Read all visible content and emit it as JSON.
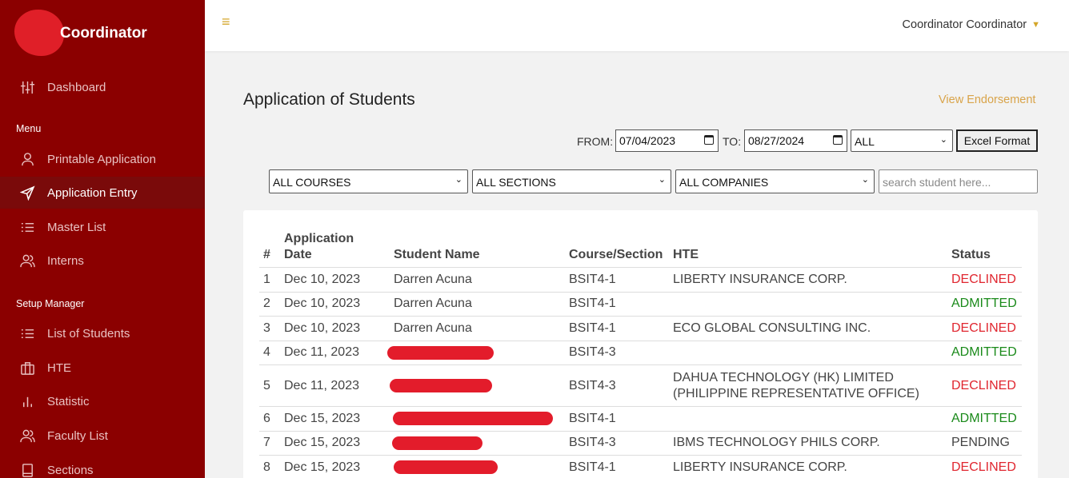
{
  "sidebar": {
    "brand": "Coordinator",
    "items": [
      {
        "label": "Dashboard",
        "icon": "sliders-icon"
      },
      {
        "label": "Printable Application",
        "icon": "user-icon"
      },
      {
        "label": "Application Entry",
        "icon": "send-icon"
      },
      {
        "label": "Master List",
        "icon": "list-icon"
      },
      {
        "label": "Interns",
        "icon": "users-icon"
      },
      {
        "label": "List of Students",
        "icon": "list-icon"
      },
      {
        "label": "HTE",
        "icon": "briefcase-icon"
      },
      {
        "label": "Statistic",
        "icon": "bar-chart-icon"
      },
      {
        "label": "Faculty List",
        "icon": "users-icon"
      },
      {
        "label": "Sections",
        "icon": "book-icon"
      }
    ],
    "section_menu": "Menu",
    "section_setup": "Setup Manager"
  },
  "topbar": {
    "hamburger": "≡",
    "user_name": "Coordinator Coordinator"
  },
  "main": {
    "title": "Application of Students",
    "view_endorsement": "View Endorsement",
    "filters": {
      "from_label": "FROM:",
      "from_value": "07/04/2023",
      "to_label": "TO:",
      "to_value": "08/27/2024",
      "status_value": "ALL",
      "excel_label": "Excel Format",
      "course_value": "ALL COURSES",
      "section_value": "ALL SECTIONS",
      "company_value": "ALL COMPANIES",
      "search_placeholder": "search student here..."
    },
    "table": {
      "headers": {
        "num": "#",
        "date_line1": "Application",
        "date_line2": "Date",
        "student": "Student Name",
        "course": "Course/Section",
        "hte": "HTE",
        "status": "Status"
      },
      "rows": [
        {
          "num": "1",
          "date": "Dec 10, 2023",
          "student": "Darren Acuna",
          "course": "BSIT4-1",
          "hte": "LIBERTY INSURANCE CORP.",
          "status": "DECLINED"
        },
        {
          "num": "2",
          "date": "Dec 10, 2023",
          "student": "Darren Acuna",
          "course": "BSIT4-1",
          "hte": "",
          "status": "ADMITTED"
        },
        {
          "num": "3",
          "date": "Dec 10, 2023",
          "student": "Darren Acuna",
          "course": "BSIT4-1",
          "hte": "ECO GLOBAL CONSULTING INC.",
          "status": "DECLINED"
        },
        {
          "num": "4",
          "date": "Dec 11, 2023",
          "student": "",
          "course": "BSIT4-3",
          "hte": "",
          "status": "ADMITTED"
        },
        {
          "num": "5",
          "date": "Dec 11, 2023",
          "student": "",
          "course": "BSIT4-3",
          "hte_line1": "DAHUA TECHNOLOGY (HK) LIMITED",
          "hte_line2": "(PHILIPPINE REPRESENTATIVE OFFICE)",
          "status": "DECLINED"
        },
        {
          "num": "6",
          "date": "Dec 15, 2023",
          "student": "",
          "course": "BSIT4-1",
          "hte": "",
          "status": "ADMITTED"
        },
        {
          "num": "7",
          "date": "Dec 15, 2023",
          "student": "",
          "course": "BSIT4-3",
          "hte": "IBMS TECHNOLOGY PHILS CORP.",
          "status": "PENDING"
        },
        {
          "num": "8",
          "date": "Dec 15, 2023",
          "student": "",
          "course": "BSIT4-1",
          "hte": "LIBERTY INSURANCE CORP.",
          "status": "DECLINED"
        }
      ]
    }
  },
  "colors": {
    "sidebar_bg": "#8b0000",
    "accent": "#d4a62a",
    "declined": "#e0262f",
    "admitted": "#1a8a1a",
    "redaction": "#e31c2b"
  }
}
